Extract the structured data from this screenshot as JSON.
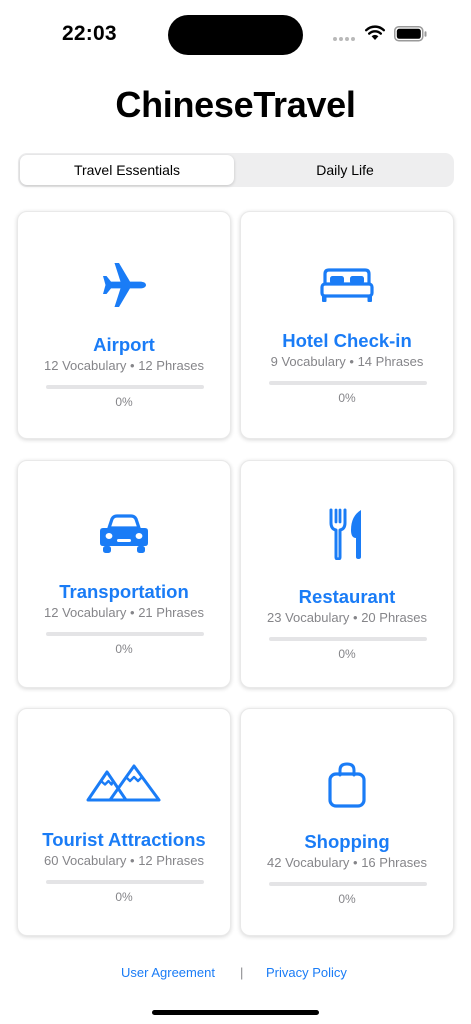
{
  "status_bar": {
    "time": "22:03"
  },
  "app": {
    "title": "ChineseTravel"
  },
  "tabs": [
    {
      "label": "Travel Essentials",
      "selected": true
    },
    {
      "label": "Daily Life",
      "selected": false
    }
  ],
  "cards": [
    {
      "icon": "airplane-icon",
      "title": "Airport",
      "counts": "12 Vocabulary • 12 Phrases",
      "progress": 0,
      "progress_label": "0%"
    },
    {
      "icon": "bed-icon",
      "title": "Hotel Check-in",
      "counts": "9 Vocabulary • 14 Phrases",
      "progress": 0,
      "progress_label": "0%"
    },
    {
      "icon": "car-icon",
      "title": "Transportation",
      "counts": "12 Vocabulary • 21 Phrases",
      "progress": 0,
      "progress_label": "0%"
    },
    {
      "icon": "fork-knife-icon",
      "title": "Restaurant",
      "counts": "23 Vocabulary • 20 Phrases",
      "progress": 0,
      "progress_label": "0%"
    },
    {
      "icon": "mountains-icon",
      "title": "Tourist Attractions",
      "counts": "60 Vocabulary • 12 Phrases",
      "progress": 0,
      "progress_label": "0%"
    },
    {
      "icon": "shopping-bag-icon",
      "title": "Shopping",
      "counts": "42 Vocabulary • 16 Phrases",
      "progress": 0,
      "progress_label": "0%"
    }
  ],
  "footer": {
    "user_agreement": "User Agreement",
    "separator": "|",
    "privacy_policy": "Privacy Policy"
  },
  "colors": {
    "accent": "#1a7cf6",
    "secondary_text": "#858589"
  }
}
